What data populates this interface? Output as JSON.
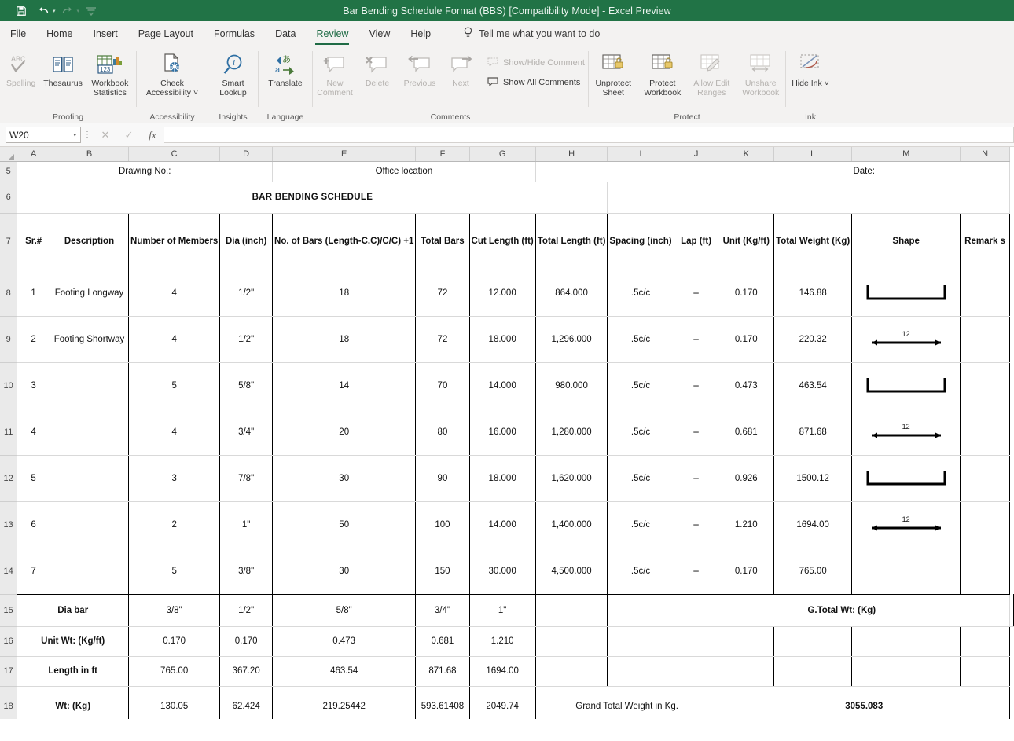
{
  "titlebar": {
    "title": "Bar Bending Schedule Format (BBS)  [Compatibility Mode]  -  Excel Preview",
    "quick_access": [
      {
        "name": "save-icon",
        "glyph": "💾"
      },
      {
        "name": "undo-icon",
        "glyph": "↶"
      },
      {
        "name": "redo-icon",
        "glyph": "↷"
      },
      {
        "name": "customize-qat-icon",
        "glyph": "⤓"
      }
    ]
  },
  "tabs": [
    {
      "label": "File",
      "active": false
    },
    {
      "label": "Home",
      "active": false
    },
    {
      "label": "Insert",
      "active": false
    },
    {
      "label": "Page Layout",
      "active": false
    },
    {
      "label": "Formulas",
      "active": false
    },
    {
      "label": "Data",
      "active": false
    },
    {
      "label": "Review",
      "active": true
    },
    {
      "label": "View",
      "active": false
    },
    {
      "label": "Help",
      "active": false
    }
  ],
  "tell_me": {
    "label": "Tell me what you want to do",
    "icon": "lightbulb-icon"
  },
  "ribbon": {
    "groups": [
      {
        "name": "proofing",
        "label": "Proofing",
        "commands": [
          {
            "name": "spelling",
            "label": "Spelling",
            "disabled": true
          },
          {
            "name": "thesaurus",
            "label": "Thesaurus",
            "disabled": false
          },
          {
            "name": "workbook-statistics",
            "label": "Workbook Statistics",
            "disabled": false
          }
        ]
      },
      {
        "name": "accessibility",
        "label": "Accessibility",
        "commands": [
          {
            "name": "check-accessibility",
            "label": "Check Accessibility ˅",
            "disabled": false
          }
        ]
      },
      {
        "name": "insights",
        "label": "Insights",
        "commands": [
          {
            "name": "smart-lookup",
            "label": "Smart Lookup",
            "disabled": false
          }
        ]
      },
      {
        "name": "language",
        "label": "Language",
        "commands": [
          {
            "name": "translate",
            "label": "Translate",
            "disabled": false
          }
        ]
      },
      {
        "name": "comments",
        "label": "Comments",
        "commands": [
          {
            "name": "new-comment",
            "label": "New Comment",
            "disabled": true
          },
          {
            "name": "delete-comment",
            "label": "Delete",
            "disabled": true
          },
          {
            "name": "previous-comment",
            "label": "Previous",
            "disabled": true
          },
          {
            "name": "next-comment",
            "label": "Next",
            "disabled": true
          }
        ],
        "rows": [
          {
            "name": "show-hide-comment",
            "label": "Show/Hide Comment",
            "disabled": true
          },
          {
            "name": "show-all-comments",
            "label": "Show All Comments",
            "disabled": false
          }
        ]
      },
      {
        "name": "protect",
        "label": "Protect",
        "commands": [
          {
            "name": "unprotect-sheet",
            "label": "Unprotect Sheet",
            "disabled": false
          },
          {
            "name": "protect-workbook",
            "label": "Protect Workbook",
            "disabled": false
          },
          {
            "name": "allow-edit-ranges",
            "label": "Allow Edit Ranges",
            "disabled": true
          },
          {
            "name": "unshare-workbook",
            "label": "Unshare Workbook",
            "disabled": true
          }
        ]
      },
      {
        "name": "ink",
        "label": "Ink",
        "commands": [
          {
            "name": "hide-ink",
            "label": "Hide Ink ˅",
            "disabled": false
          }
        ]
      }
    ]
  },
  "formula_bar": {
    "name_box_value": "W20",
    "cancel_icon": "cancel-icon",
    "enter_icon": "check-icon",
    "fx_icon": "fx-icon",
    "formula_value": ""
  },
  "grid": {
    "column_headers": [
      "A",
      "B",
      "C",
      "D",
      "E",
      "F",
      "G",
      "H",
      "I",
      "J",
      "K",
      "L",
      "M",
      "N"
    ],
    "row_headers": [
      "5",
      "6",
      "7",
      "8",
      "9",
      "10",
      "11",
      "12",
      "13",
      "14",
      "15",
      "16",
      "17",
      "18"
    ]
  },
  "sheet": {
    "row5": {
      "drawing_no": "Drawing No.:",
      "office_location": "Office location",
      "date": "Date:"
    },
    "row6_title": "BAR BENDING SCHEDULE",
    "headers": {
      "sr": "Sr.#",
      "description": "Description",
      "number_of_members": "Number of Members",
      "dia": "Dia (inch)",
      "no_of_bars": "No. of Bars (Length-C.C)/C/C)  +1",
      "total_bars": "Total Bars",
      "cut_length": "Cut Length (ft)",
      "total_length": "Total Length (ft)",
      "spacing": "Spacing (inch)",
      "lap": "Lap (ft)",
      "unit": "Unit (Kg/ft)",
      "total_weight": "Total Weight (Kg)",
      "shape": "Shape",
      "remarks": "Remark s"
    },
    "rows": [
      {
        "sr": "1",
        "description": "Footing Longway",
        "members": "4",
        "dia": "1/2\"",
        "bars": "18",
        "total_bars": "72",
        "cut_length": "12.000",
        "total_length": "864.000",
        "spacing": ".5c/c",
        "lap": "--",
        "unit": "0.170",
        "total_weight": "146.88",
        "shape": "u-bar",
        "shape_label": "",
        "remarks": ""
      },
      {
        "sr": "2",
        "description": "Footing Shortway",
        "members": "4",
        "dia": "1/2\"",
        "bars": "18",
        "total_bars": "72",
        "cut_length": "18.000",
        "total_length": "1,296.000",
        "spacing": ".5c/c",
        "lap": "--",
        "unit": "0.170",
        "total_weight": "220.32",
        "shape": "straight-bar",
        "shape_label": "12",
        "remarks": ""
      },
      {
        "sr": "3",
        "description": "",
        "members": "5",
        "dia": "5/8\"",
        "bars": "14",
        "total_bars": "70",
        "cut_length": "14.000",
        "total_length": "980.000",
        "spacing": ".5c/c",
        "lap": "--",
        "unit": "0.473",
        "total_weight": "463.54",
        "shape": "u-bar",
        "shape_label": "",
        "remarks": ""
      },
      {
        "sr": "4",
        "description": "",
        "members": "4",
        "dia": "3/4\"",
        "bars": "20",
        "total_bars": "80",
        "cut_length": "16.000",
        "total_length": "1,280.000",
        "spacing": ".5c/c",
        "lap": "--",
        "unit": "0.681",
        "total_weight": "871.68",
        "shape": "straight-bar",
        "shape_label": "12",
        "remarks": ""
      },
      {
        "sr": "5",
        "description": "",
        "members": "3",
        "dia": "7/8\"",
        "bars": "30",
        "total_bars": "90",
        "cut_length": "18.000",
        "total_length": "1,620.000",
        "spacing": ".5c/c",
        "lap": "--",
        "unit": "0.926",
        "total_weight": "1500.12",
        "shape": "u-bar",
        "shape_label": "",
        "remarks": ""
      },
      {
        "sr": "6",
        "description": "",
        "members": "2",
        "dia": "1\"",
        "bars": "50",
        "total_bars": "100",
        "cut_length": "14.000",
        "total_length": "1,400.000",
        "spacing": ".5c/c",
        "lap": "--",
        "unit": "1.210",
        "total_weight": "1694.00",
        "shape": "straight-bar",
        "shape_label": "12",
        "remarks": ""
      },
      {
        "sr": "7",
        "description": "",
        "members": "5",
        "dia": "3/8\"",
        "bars": "30",
        "total_bars": "150",
        "cut_length": "30.000",
        "total_length": "4,500.000",
        "spacing": ".5c/c",
        "lap": "--",
        "unit": "0.170",
        "total_weight": "765.00",
        "shape": "none",
        "shape_label": "",
        "remarks": ""
      }
    ],
    "summary": {
      "dia_bar_label": "Dia bar",
      "dia_bar_values": [
        "3/8\"",
        "1/2\"",
        "5/8\"",
        "3/4\"",
        "1\""
      ],
      "gtotal_label": "G.Total Wt: (Kg)",
      "unit_wt_label": "Unit Wt: (Kg/ft)",
      "unit_wt_values": [
        "0.170",
        "0.170",
        "0.473",
        "0.681",
        "1.210"
      ],
      "length_label": "Length in ft",
      "length_values": [
        "765.00",
        "367.20",
        "463.54",
        "871.68",
        "1694.00"
      ],
      "wt_label": "Wt: (Kg)",
      "wt_values": [
        "130.05",
        "62.424",
        "219.25442",
        "593.61408",
        "2049.74"
      ],
      "grand_total_label": "Grand Total Weight in Kg.",
      "grand_total_value": "3055.083"
    }
  },
  "colors": {
    "brand_green": "#217346",
    "header_gray": "#d9d9d9",
    "peach": "#fbd5b5",
    "green": "#92d050",
    "blue": "#a3b8d8",
    "amber": "#ffc000",
    "title_black": "#0d0d0d"
  },
  "chart_data": {
    "type": "table",
    "title": "BAR BENDING SCHEDULE",
    "columns": [
      "Sr.#",
      "Description",
      "Number of Members",
      "Dia (inch)",
      "No. of Bars (Length-C.C)/C/C) +1",
      "Total Bars",
      "Cut Length (ft)",
      "Total Length (ft)",
      "Spacing (inch)",
      "Lap (ft)",
      "Unit (Kg/ft)",
      "Total Weight (Kg)",
      "Shape",
      "Remarks"
    ],
    "rows": [
      [
        "1",
        "Footing Longway",
        4,
        "1/2\"",
        18,
        72,
        12.0,
        864.0,
        ".5c/c",
        "--",
        0.17,
        146.88,
        "u-bar",
        ""
      ],
      [
        "2",
        "Footing Shortway",
        4,
        "1/2\"",
        18,
        72,
        18.0,
        1296.0,
        ".5c/c",
        "--",
        0.17,
        220.32,
        "straight-bar 12",
        ""
      ],
      [
        "3",
        "",
        5,
        "5/8\"",
        14,
        70,
        14.0,
        980.0,
        ".5c/c",
        "--",
        0.473,
        463.54,
        "u-bar",
        ""
      ],
      [
        "4",
        "",
        4,
        "3/4\"",
        20,
        80,
        16.0,
        1280.0,
        ".5c/c",
        "--",
        0.681,
        871.68,
        "straight-bar 12",
        ""
      ],
      [
        "5",
        "",
        3,
        "7/8\"",
        30,
        90,
        18.0,
        1620.0,
        ".5c/c",
        "--",
        0.926,
        1500.12,
        "u-bar",
        ""
      ],
      [
        "6",
        "",
        2,
        "1\"",
        50,
        100,
        14.0,
        1400.0,
        ".5c/c",
        "--",
        1.21,
        1694.0,
        "straight-bar 12",
        ""
      ],
      [
        "7",
        "",
        5,
        "3/8\"",
        30,
        150,
        30.0,
        4500.0,
        ".5c/c",
        "--",
        0.17,
        765.0,
        "",
        ""
      ]
    ],
    "summary_table": {
      "dia_bar": [
        "3/8\"",
        "1/2\"",
        "5/8\"",
        "3/4\"",
        "1\""
      ],
      "unit_wt_kg_per_ft": [
        0.17,
        0.17,
        0.473,
        0.681,
        1.21
      ],
      "length_in_ft": [
        765.0,
        367.2,
        463.54,
        871.68,
        1694.0
      ],
      "wt_kg": [
        130.05,
        62.424,
        219.25442,
        593.61408,
        2049.74
      ],
      "grand_total_weight_kg": 3055.083
    }
  }
}
